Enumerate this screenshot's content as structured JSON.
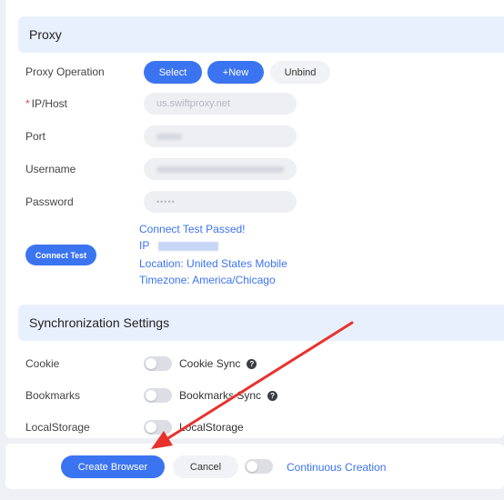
{
  "proxy": {
    "header": "Proxy",
    "operation_label": "Proxy Operation",
    "select_label": "Select",
    "new_label": "+New",
    "unbind_label": "Unbind",
    "ip_host_required": "*",
    "ip_host_label": "IP/Host",
    "ip_host_value": "us.swiftproxy.net",
    "port_label": "Port",
    "username_label": "Username",
    "password_label": "Password",
    "password_value": "•••••",
    "connect_test_label": "Connect Test",
    "result": {
      "status": "Connect Test Passed!",
      "ip_label": "IP",
      "location": "Location: United States Mobile",
      "timezone": "Timezone: America/Chicago"
    }
  },
  "sync": {
    "header": "Synchronization Settings",
    "rows": [
      {
        "label": "Cookie",
        "toggle_label": "Cookie Sync",
        "help": "?",
        "enabled": false
      },
      {
        "label": "Bookmarks",
        "toggle_label": "Bookmarks Sync",
        "help": "?",
        "enabled": false
      },
      {
        "label": "LocalStorage",
        "toggle_label": "LocalStorage",
        "enabled": false
      }
    ]
  },
  "footer": {
    "create_label": "Create Browser",
    "cancel_label": "Cancel",
    "continuous_label": "Continuous Creation",
    "continuous_enabled": false
  },
  "colors": {
    "accent": "#3b74f0",
    "section_bg": "#e9f0fd",
    "annotation_arrow": "#e8322d"
  },
  "icons": {
    "help": "question-circle-icon",
    "annotation": "red-arrow-icon"
  }
}
